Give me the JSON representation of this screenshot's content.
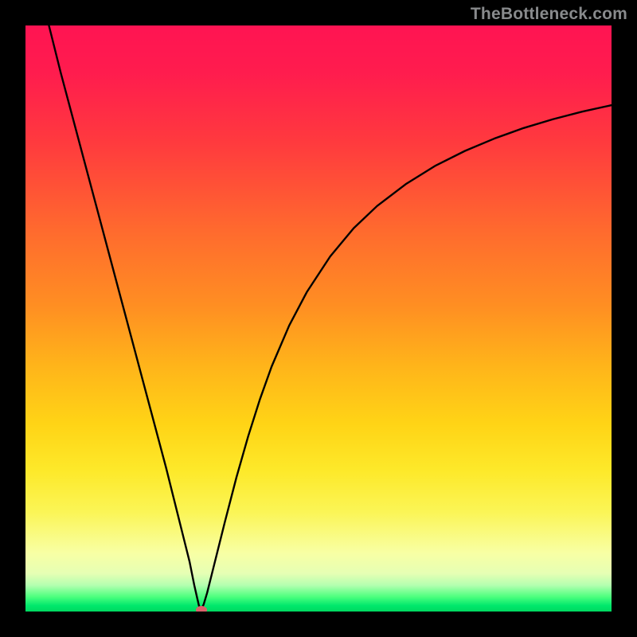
{
  "watermark": "TheBottleneck.com",
  "chart_data": {
    "type": "line",
    "title": "",
    "xlabel": "",
    "ylabel": "",
    "xlim": [
      0,
      100
    ],
    "ylim": [
      0,
      100
    ],
    "series": [
      {
        "name": "curve",
        "x": [
          4,
          6,
          8,
          10,
          12,
          14,
          16,
          18,
          20,
          22,
          24,
          26,
          27,
          28,
          28.8,
          29.3,
          29.6,
          30,
          30.4,
          31,
          32,
          33,
          34,
          36,
          38,
          40,
          42,
          45,
          48,
          52,
          56,
          60,
          65,
          70,
          75,
          80,
          85,
          90,
          95,
          100
        ],
        "y": [
          100,
          92,
          84.5,
          77,
          69.5,
          62,
          54.5,
          47,
          39.5,
          32,
          24.5,
          16.5,
          12.5,
          8.5,
          4.5,
          2.3,
          1.0,
          0.4,
          1.2,
          3.2,
          7.2,
          11.2,
          15.2,
          22.9,
          29.9,
          36.2,
          41.8,
          48.8,
          54.5,
          60.6,
          65.4,
          69.2,
          73.0,
          76.1,
          78.6,
          80.7,
          82.5,
          84.0,
          85.3,
          86.4
        ]
      }
    ],
    "marker": {
      "x": 30,
      "y": 0,
      "color": "#da626b"
    },
    "gradient_stops": [
      {
        "pos": 0.0,
        "color": "#ff1452"
      },
      {
        "pos": 0.2,
        "color": "#ff3a3e"
      },
      {
        "pos": 0.48,
        "color": "#ff8f22"
      },
      {
        "pos": 0.76,
        "color": "#fde92a"
      },
      {
        "pos": 0.9,
        "color": "#f8ffa4"
      },
      {
        "pos": 0.975,
        "color": "#4cff7e"
      },
      {
        "pos": 1.0,
        "color": "#00d860"
      }
    ]
  }
}
